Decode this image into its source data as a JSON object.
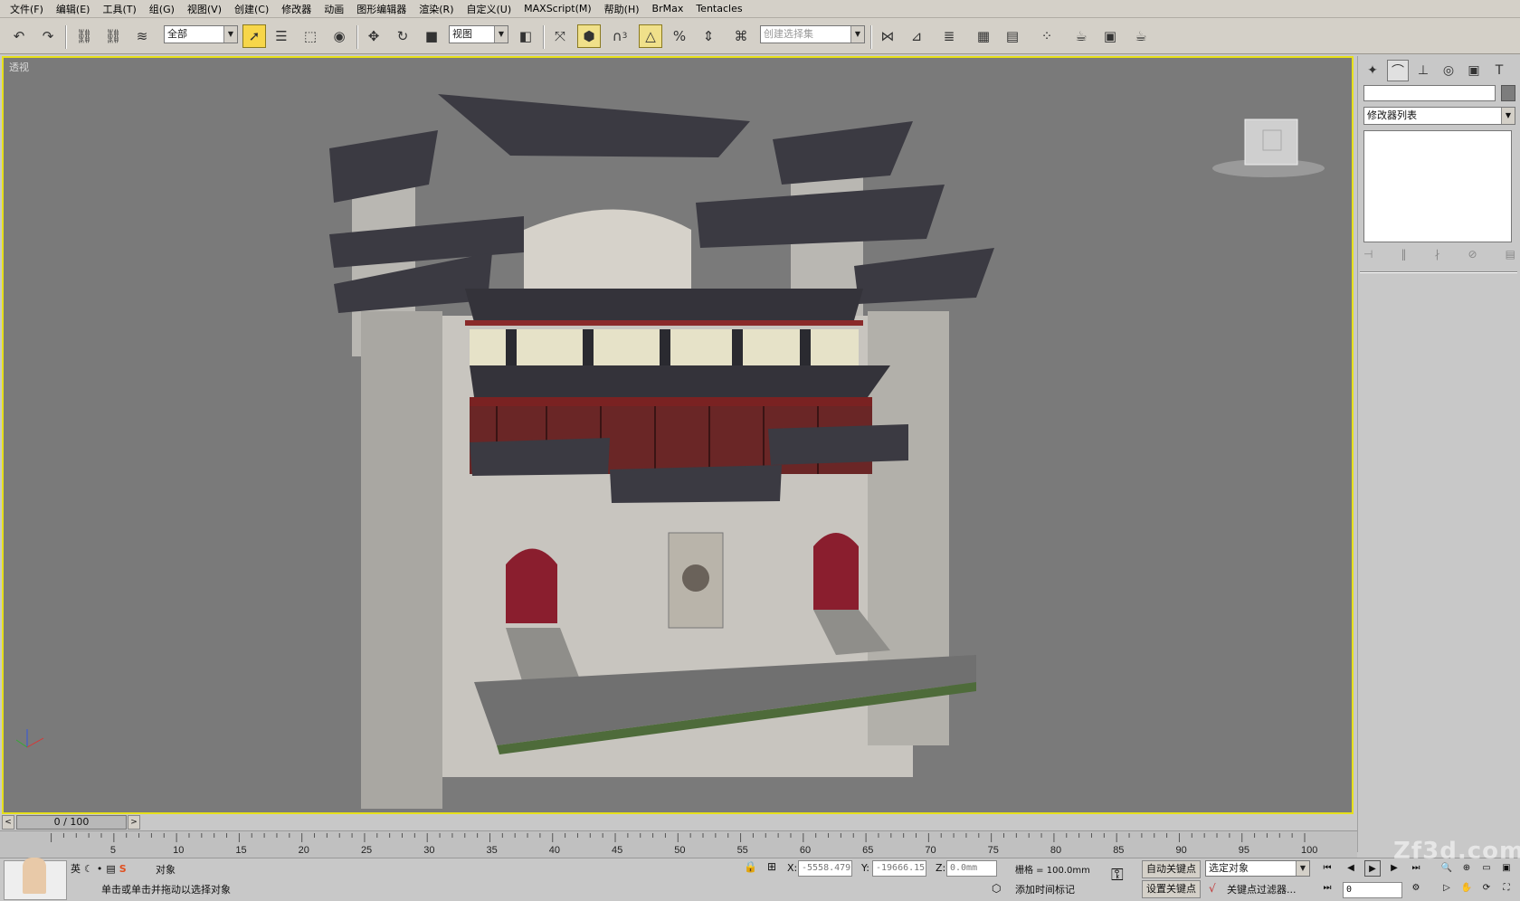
{
  "menu": [
    "文件(F)",
    "编辑(E)",
    "工具(T)",
    "组(G)",
    "视图(V)",
    "创建(C)",
    "修改器",
    "动画",
    "图形编辑器",
    "渲染(R)",
    "自定义(U)",
    "MAXScript(M)",
    "帮助(H)",
    "BrMax",
    "Tentacles"
  ],
  "toolbar": {
    "selection_filter": "全部",
    "ref_coord": "视图",
    "named_selection_placeholder": "创建选择集",
    "snap_count": "3"
  },
  "viewport": {
    "label": "透视",
    "accent": "#e6e01a"
  },
  "command_panel": {
    "modifier_list": "修改器列表"
  },
  "timeline": {
    "frame_display": "0 / 100",
    "ticks": [
      "5",
      "10",
      "15",
      "20",
      "25",
      "30",
      "35",
      "40",
      "45",
      "50",
      "55",
      "60",
      "65",
      "70",
      "75",
      "80",
      "85",
      "90",
      "95",
      "100"
    ]
  },
  "status": {
    "selected": "对象",
    "prompt": "单击或单击并拖动以选择对象",
    "x_label": "X:",
    "y_label": "Y:",
    "z_label": "Z:",
    "x": "-5558.479",
    "y": "-19666.15",
    "z": "0.0mm",
    "grid": "栅格 = 100.0mm",
    "auto_key": "自动关键点",
    "set_key": "设置关键点",
    "selected_set": "选定对象",
    "key_filters": "关键点过滤器...",
    "add_time_tag": "添加时间标记",
    "frame_spinner": "0",
    "script_icon_label": "S"
  },
  "watermark": "Zf3d.com"
}
